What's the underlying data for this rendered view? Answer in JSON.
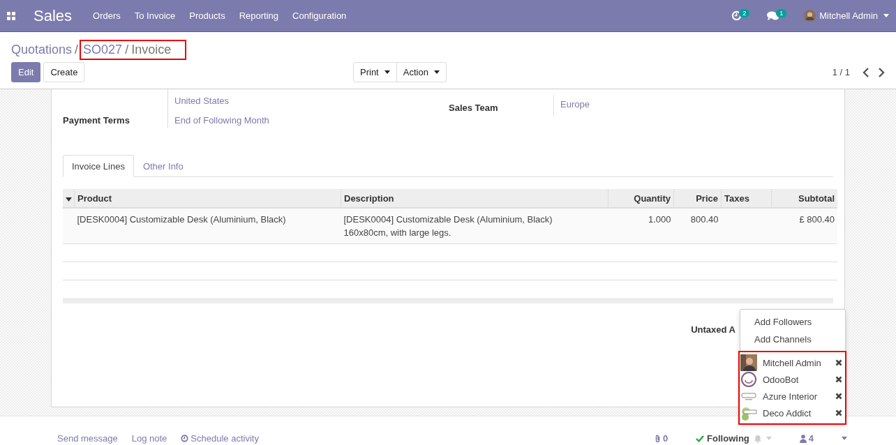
{
  "navbar": {
    "app_name": "Sales",
    "menu": [
      "Orders",
      "To Invoice",
      "Products",
      "Reporting",
      "Configuration"
    ],
    "activity_count": "2",
    "message_count": "1",
    "user": "Mitchell Admin"
  },
  "breadcrumb": [
    "Quotations",
    "SO027",
    "Invoice"
  ],
  "breadcrumb_separators": [
    "/",
    "/"
  ],
  "buttons": {
    "edit": "Edit",
    "create": "Create",
    "print": "Print",
    "action": "Action"
  },
  "pager": "1 / 1",
  "fields_left": [
    {
      "value": "United States"
    },
    {
      "label": "Payment Terms",
      "value": "End of Following Month"
    }
  ],
  "fields_right": [
    {
      "label": "Sales Team",
      "value": "Europe"
    }
  ],
  "tabs": [
    {
      "label": "Invoice Lines",
      "selected": true
    },
    {
      "label": "Other Info",
      "selected": false
    }
  ],
  "table": {
    "columns": [
      "Product",
      "Description",
      "Quantity",
      "Price",
      "Taxes",
      "Subtotal"
    ],
    "rows": [
      {
        "product": "[DESK0004] Customizable Desk (Aluminium, Black)",
        "description": "[DESK0004] Customizable Desk (Aluminium, Black)\n160x80cm, with large legs.",
        "quantity": "1.000",
        "price": "800.40",
        "subtotal": "£ 800.40"
      }
    ]
  },
  "totals_label": "Untaxed A",
  "follower_menu": {
    "actions": [
      "Add Followers",
      "Add Channels"
    ],
    "followers": [
      {
        "name": "Mitchell Admin"
      },
      {
        "name": "OdooBot",
        "kind": "bot"
      },
      {
        "name": "Azure Interior",
        "kind": "azure"
      },
      {
        "name": "Deco Addict",
        "kind": "deco"
      }
    ]
  },
  "chatter": {
    "links": [
      "Send message",
      "Log note",
      "Schedule activity"
    ],
    "attachments": "0",
    "following": "Following",
    "followers_count": "4"
  }
}
